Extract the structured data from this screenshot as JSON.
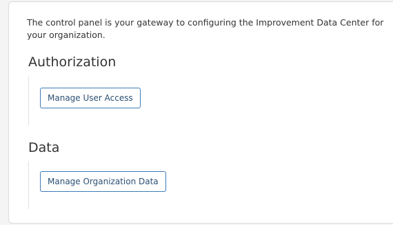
{
  "intro": {
    "text": "The control panel is your gateway to configuring the Improvement Data Center for your organization."
  },
  "sections": [
    {
      "title": "Authorization",
      "button_label": "Manage User Access"
    },
    {
      "title": "Data",
      "button_label": "Manage Organization Data"
    }
  ],
  "colors": {
    "button_border": "#3d7bb8",
    "button_text": "#2b4f74",
    "text": "#333333",
    "panel_background": "#ffffff",
    "page_background": "#f4f4f4"
  }
}
